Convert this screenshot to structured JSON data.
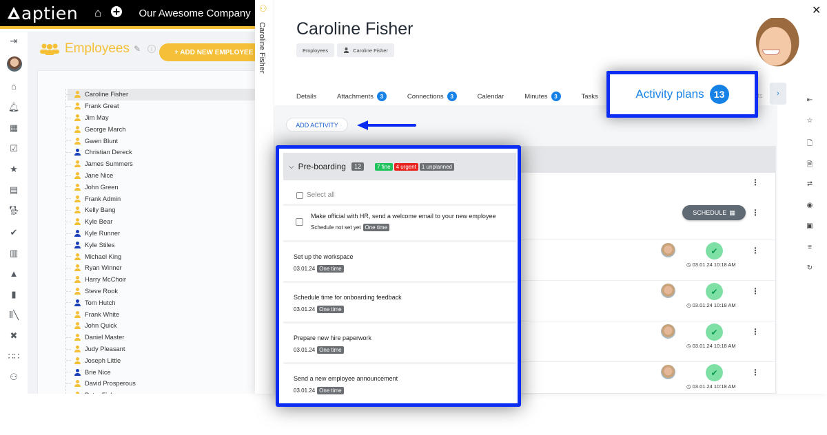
{
  "app": {
    "logo_text": "aptien",
    "company": "Our Awesome Company",
    "accent_color": "#f5c038",
    "highlight_color": "#0b2cf2",
    "link_color": "#1682e6"
  },
  "left_rail": {
    "icons": [
      "collapse-arrow-icon",
      "user-avatar",
      "home-icon",
      "bell-icon",
      "calendar-icon",
      "clipboard-check-icon",
      "star-icon",
      "document-icon",
      "dog-icon",
      "check-circle-icon",
      "report-icon",
      "person-icon",
      "clipboard-icon",
      "books-icon",
      "network-icon",
      "grid-dots-icon",
      "team-icon"
    ]
  },
  "employees": {
    "title": "Employees",
    "add_button": "+ ADD NEW EMPLOYEE",
    "list": [
      {
        "name": "Caroline Fisher",
        "color": "#f5c038",
        "selected": true
      },
      {
        "name": "Frank Great",
        "color": "#f5c038"
      },
      {
        "name": "Jim May",
        "color": "#f5c038"
      },
      {
        "name": "George March",
        "color": "#f5c038"
      },
      {
        "name": "Gwen Blunt",
        "color": "#f5c038"
      },
      {
        "name": "Christian Dereck",
        "color": "#1a3fb8"
      },
      {
        "name": "James Summers",
        "color": "#f5c038"
      },
      {
        "name": "Jane Nice",
        "color": "#f5c038"
      },
      {
        "name": "John Green",
        "color": "#f5c038"
      },
      {
        "name": "Frank Admin",
        "color": "#f5c038"
      },
      {
        "name": "Kelly Bang",
        "color": "#f5c038"
      },
      {
        "name": "Kyle Bear",
        "color": "#f5c038"
      },
      {
        "name": "Kyle Runner",
        "color": "#1a3fb8"
      },
      {
        "name": "Kyle Stiles",
        "color": "#1a3fb8"
      },
      {
        "name": "Michael King",
        "color": "#f5c038"
      },
      {
        "name": "Ryan Winner",
        "color": "#f5c038"
      },
      {
        "name": "Harry McChoir",
        "color": "#f5c038"
      },
      {
        "name": "Steve Rook",
        "color": "#f5c038"
      },
      {
        "name": "Tom Hutch",
        "color": "#1a3fb8"
      },
      {
        "name": "Frank White",
        "color": "#f5c038"
      },
      {
        "name": "John Quick",
        "color": "#f5c038"
      },
      {
        "name": "Daniel Master",
        "color": "#f5c038"
      },
      {
        "name": "Judy Pleasant",
        "color": "#f5c038"
      },
      {
        "name": "Joseph Little",
        "color": "#f5c038"
      },
      {
        "name": "Brie Nice",
        "color": "#1a3fb8"
      },
      {
        "name": "David Prosperous",
        "color": "#f5c038"
      },
      {
        "name": "Peter Fisher",
        "color": "#f5c038"
      }
    ]
  },
  "panel": {
    "vertical_tab": "Caroline Fisher",
    "title": "Caroline Fisher",
    "breadcrumbs": [
      "Employees",
      "Caroline Fisher"
    ],
    "tabs": [
      {
        "label": "Details",
        "badge": null
      },
      {
        "label": "Attachments",
        "badge": "3"
      },
      {
        "label": "Connections",
        "badge": "3"
      },
      {
        "label": "Calendar",
        "badge": null
      },
      {
        "label": "Minutes",
        "badge": "3"
      },
      {
        "label": "Tasks",
        "badge": null
      }
    ],
    "faded_tab": "sts",
    "next_tab": "›",
    "active_tab": {
      "label": "Activity plans",
      "badge": "13"
    },
    "add_activity": "ADD ACTIVITY",
    "schedule_button": "SCHEDULE",
    "right_rail_icons": [
      "collapse-left-icon",
      "star-icon",
      "file-add-icon",
      "file-icon",
      "share-icon",
      "eye-icon",
      "id-card-icon",
      "sliders-icon",
      "history-icon"
    ]
  },
  "activity_group": {
    "name": "Pre-boarding",
    "count": "12",
    "fine": "7 fine",
    "urgent": "4 urgent",
    "unplanned": "1 unplanned",
    "select_all": "Select all",
    "items": [
      {
        "title": "Make official with HR, send a welcome email to your new employee",
        "date": "Schedule not set yet",
        "recurrence": "One time",
        "completed": false
      },
      {
        "title": "Set up the workspace",
        "date": "03.01.24",
        "recurrence": "One time",
        "completed": true,
        "completed_at": "03.01.24 10:18 AM"
      },
      {
        "title": "Schedule time for onboarding feedback",
        "date": "03.01.24",
        "recurrence": "One time",
        "completed": true,
        "completed_at": "03.01.24 10:18 AM"
      },
      {
        "title": "Prepare new hire paperwork",
        "date": "03.01.24",
        "recurrence": "One time",
        "completed": true,
        "completed_at": "03.01.24 10:18 AM"
      },
      {
        "title": "Send a new employee announcement",
        "date": "03.01.24",
        "recurrence": "One time",
        "completed": true,
        "completed_at": "03.01.24 10:18 AM"
      }
    ]
  }
}
